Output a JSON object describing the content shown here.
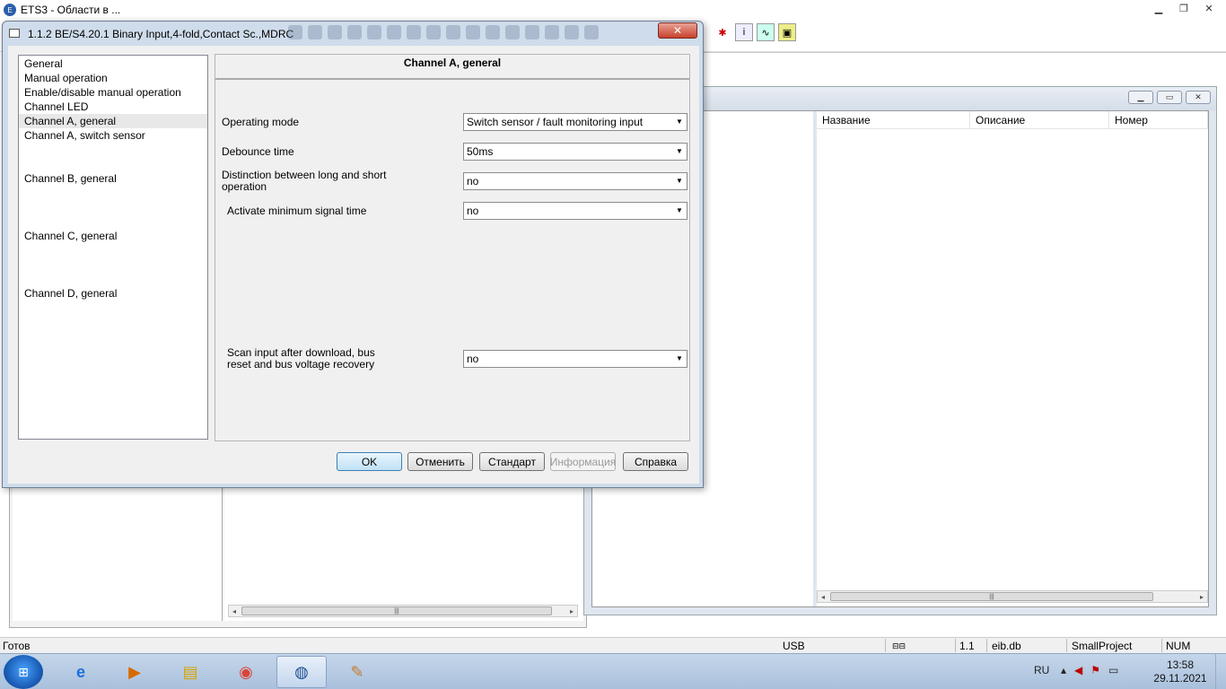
{
  "app": {
    "title": "ETS3 - Области в ..."
  },
  "dialog": {
    "title": "1.1.2 BE/S4.20.1 Binary Input,4-fold,Contact Sc.,MDRC",
    "close_label": "✕",
    "nav_items": [
      "General",
      "Manual operation",
      "Enable/disable manual operation",
      "Channel LED",
      "Channel A, general",
      "Channel A, switch sensor",
      "Channel B, general",
      "Channel C, general",
      "Channel D, general"
    ],
    "selected_item": "Channel A, general",
    "panel_title": "Channel A, general",
    "params": [
      {
        "label": "Operating mode",
        "value": "Switch sensor / fault monitoring input"
      },
      {
        "label": "Debounce time",
        "value": "50ms"
      },
      {
        "label": "Distinction between long and short operation",
        "value": "no"
      },
      {
        "label": "Activate minimum signal time",
        "value": "no"
      },
      {
        "label": "Scan input after download, bus reset and bus voltage recovery",
        "value": "no"
      }
    ],
    "buttons": {
      "ok": "OK",
      "cancel": "Отменить",
      "standard": "Стандарт",
      "info": "Информация",
      "help": "Справка"
    }
  },
  "list": {
    "columns": [
      "Название",
      "Описание",
      "Номер"
    ]
  },
  "statusbar": {
    "ready": "Готов",
    "interface": "USB",
    "address": "1.1",
    "db": "eib.db",
    "project": "SmallProject",
    "num": "NUM"
  },
  "taskbar": {
    "lang": "RU",
    "time": "13:58",
    "date": "29.11.2021"
  }
}
